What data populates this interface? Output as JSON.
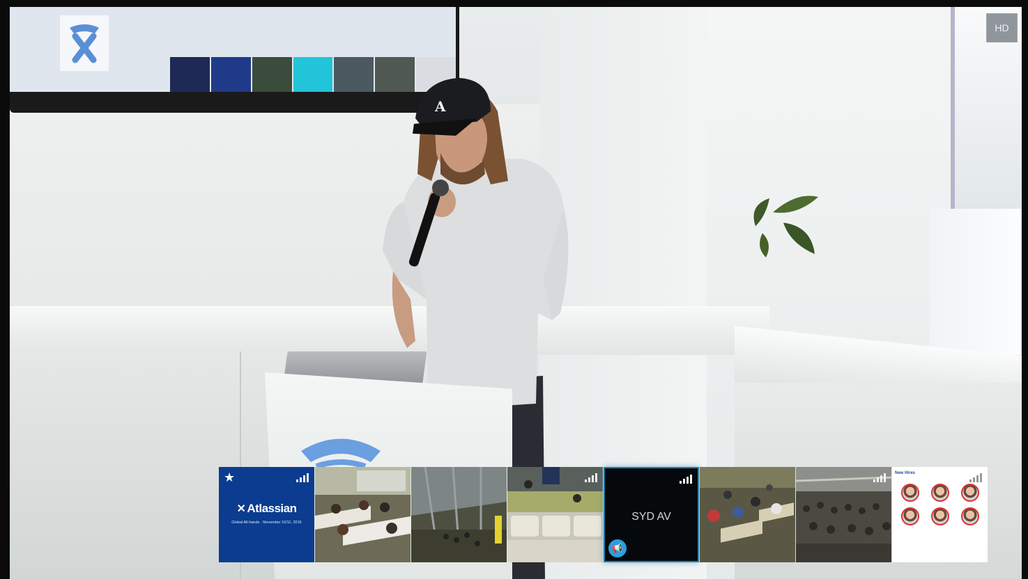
{
  "call": {
    "quality_badge": "HD",
    "main_video": {
      "description_icon": "main-speaker-video"
    }
  },
  "participants": [
    {
      "id": "brand",
      "starred": true,
      "brand": "Atlassian",
      "subtitle": "Global All-hands · November 10/11, 2016"
    },
    {
      "id": "room-2"
    },
    {
      "id": "room-3"
    },
    {
      "id": "room-4"
    },
    {
      "id": "syd-av",
      "label": "SYD AV",
      "active": true,
      "icon": "megaphone-icon"
    },
    {
      "id": "room-6"
    },
    {
      "id": "room-7"
    },
    {
      "id": "remote-people",
      "title": "New Hires",
      "avatars": [
        "",
        "",
        "",
        "",
        "",
        ""
      ]
    }
  ],
  "colors": {
    "brand_blue": "#0b3c8f",
    "active_border": "#2a7aa3",
    "megaphone": "#2a9ee0"
  }
}
